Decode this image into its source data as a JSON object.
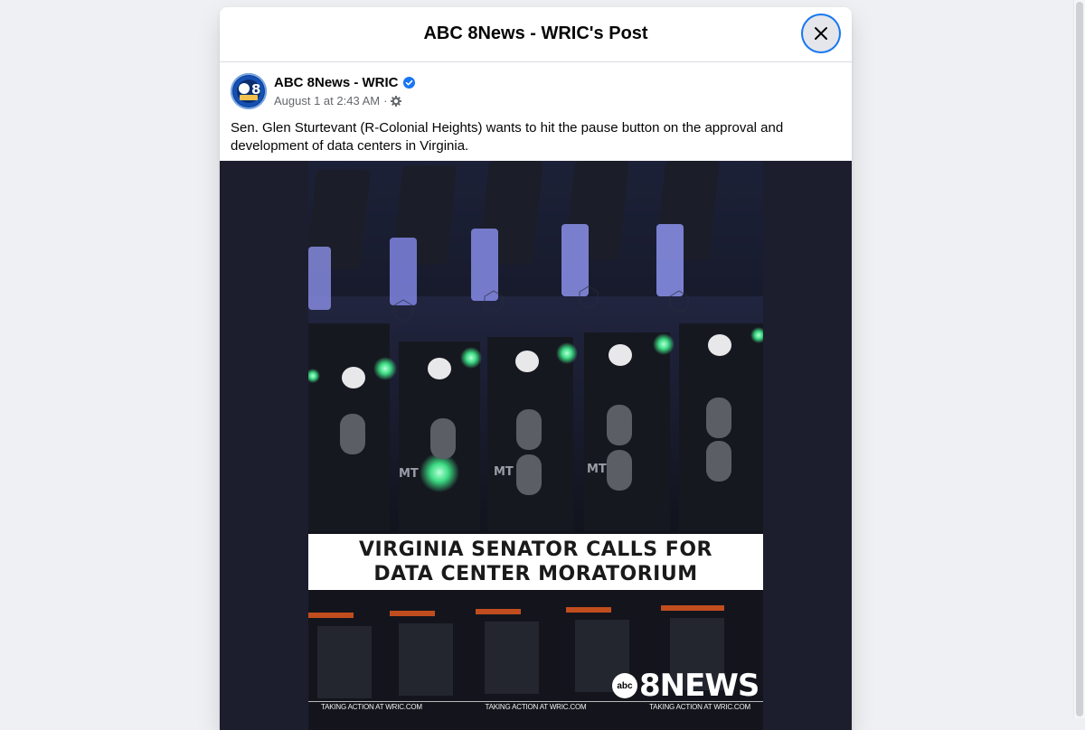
{
  "modal": {
    "title": "ABC 8News - WRIC's Post",
    "close_icon": "close-icon"
  },
  "post": {
    "page_name": "ABC 8News - WRIC",
    "verified_icon": "verified-badge-icon",
    "timestamp": "August 1 at 2:43 AM",
    "separator": "·",
    "audience_icon": "gear-icon",
    "text": "Sen. Glen Sturtevant (R-Colonial Heights) wants to hit the pause button on the approval and development of data centers in Virginia."
  },
  "video": {
    "headline_line1": "VIRGINIA SENATOR CALLS FOR",
    "headline_line2": "DATA CENTER MORATORIUM",
    "ticker": [
      "TAKING ACTION AT WRIC.COM",
      "TAKING ACTION AT WRIC.COM",
      "TAKING ACTION AT WRIC.COM"
    ],
    "logo_abc": "abc",
    "logo_text": "8NEWS",
    "server_labels": [
      "MT",
      "MT",
      "MT"
    ]
  },
  "colors": {
    "accent": "#1877f2",
    "media_background": "#1c1e2e",
    "led_green": "#3ddc84"
  }
}
